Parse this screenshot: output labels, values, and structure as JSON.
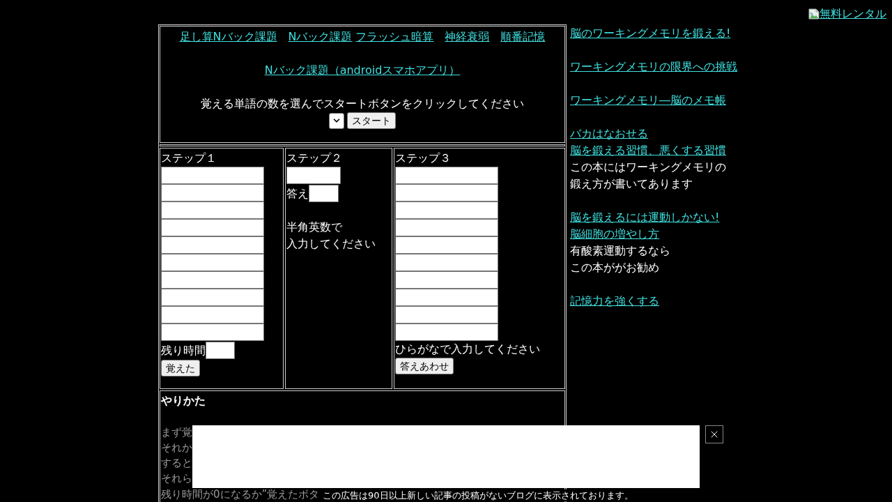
{
  "top_link": "無料レンタル",
  "menu": {
    "nav_links": [
      "足し算Nバック課題",
      "Nバック課題",
      "フラッシュ暗算",
      "神経衰弱",
      "順番記憶"
    ],
    "app_link": "Nバック課題（androidスマホアプリ）",
    "instruction": "覚える単語の数を選んでスタートボタンをクリックしてください",
    "start_button": "スタート"
  },
  "steps": [
    {
      "kind": "memorize",
      "title": "ステップ１",
      "timer_label": "残り時間",
      "button": "覚えた"
    },
    {
      "kind": "answer",
      "title": "ステップ２",
      "answer_label": "答え",
      "hint_lines": [
        "半角英数で",
        "入力してください"
      ]
    },
    {
      "kind": "recall",
      "title": "ステップ３",
      "hint": "ひらがなで入力してください",
      "button": "答えあわせ"
    }
  ],
  "how_to": {
    "title": "やりかた",
    "lines": [
      "まず覚",
      "それか",
      "すると",
      "それら",
      "残り時間が0になるか”覚えたボタ"
    ]
  },
  "sidebar": {
    "groups": [
      [
        {
          "kind": "link",
          "text": "脳のワーキングメモリを鍛える!"
        }
      ],
      [
        {
          "kind": "link",
          "text": "ワーキングメモリの限界への挑戦"
        }
      ],
      [
        {
          "kind": "link",
          "text": "ワーキングメモリ―脳のメモ帳"
        }
      ],
      [
        {
          "kind": "link",
          "text": "バカはなおせる"
        },
        {
          "kind": "link",
          "text": "脳を鍛える習慣、悪くする習慣"
        },
        {
          "kind": "text",
          "text": "この本にはワーキングメモリの"
        },
        {
          "kind": "text",
          "text": "鍛え方が書いてあります"
        }
      ],
      [
        {
          "kind": "link",
          "text": "脳を鍛えるには運動しかない!"
        },
        {
          "kind": "link",
          "text": "脳細胞の増やし方"
        },
        {
          "kind": "text",
          "text": "有酸素運動するなら"
        },
        {
          "kind": "text",
          "text": "この本ががお勧め"
        }
      ],
      [
        {
          "kind": "link",
          "text": "記憶力を強くする"
        }
      ]
    ]
  },
  "ad": {
    "notice": "この広告は90日以上新しい記事の投稿がないブログに表示されております。"
  }
}
